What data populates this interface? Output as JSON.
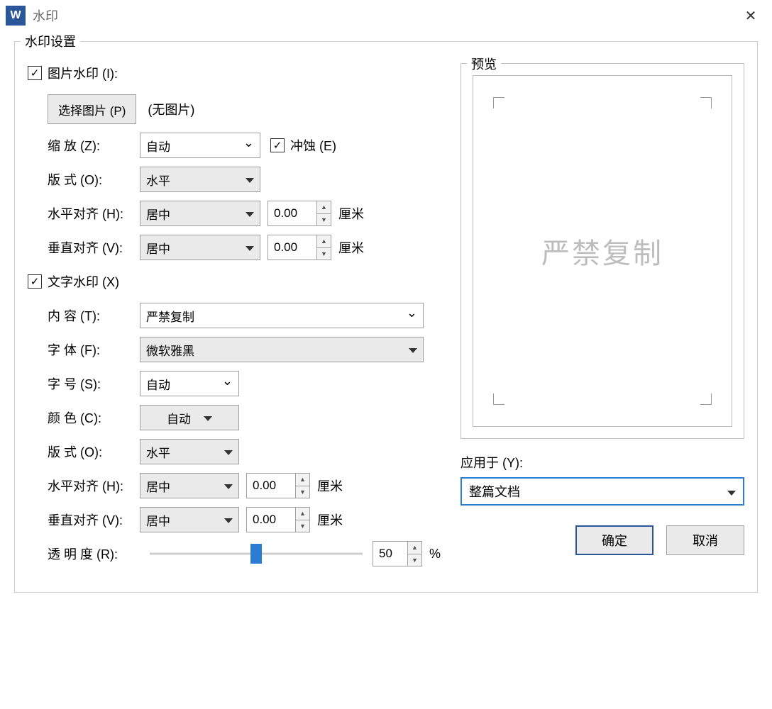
{
  "window": {
    "icon_letter": "W",
    "title": "水印"
  },
  "group": {
    "settings_title": "水印设置",
    "preview_title": "预览"
  },
  "pic": {
    "checkbox_label": "图片水印 (I):",
    "select_button": "选择图片 (P)",
    "no_image": "(无图片)",
    "scale_label": "缩   放 (Z):",
    "scale_value": "自动",
    "washout_label": "冲蚀 (E)",
    "layout_label": "版   式 (O):",
    "layout_value": "水平",
    "halign_label": "水平对齐 (H):",
    "halign_value": "居中",
    "halign_offset": "0.00",
    "valign_label": "垂直对齐 (V):",
    "valign_value": "居中",
    "valign_offset": "0.00",
    "unit": "厘米"
  },
  "text": {
    "checkbox_label": "文字水印 (X)",
    "content_label": "内   容 (T):",
    "content_value": "严禁复制",
    "font_label": "字   体 (F):",
    "font_value": "微软雅黑",
    "size_label": "字   号 (S):",
    "size_value": "自动",
    "color_label": "颜   色 (C):",
    "color_value": "自动",
    "layout_label": "版   式 (O):",
    "layout_value": "水平",
    "halign_label": "水平对齐 (H):",
    "halign_value": "居中",
    "halign_offset": "0.00",
    "valign_label": "垂直对齐 (V):",
    "valign_value": "居中",
    "valign_offset": "0.00",
    "unit": "厘米",
    "opacity_label": "透 明 度 (R):",
    "opacity_value": "50",
    "opacity_unit": "%"
  },
  "apply": {
    "label": "应用于 (Y):",
    "value": "整篇文档"
  },
  "buttons": {
    "ok": "确定",
    "cancel": "取消"
  },
  "preview_text": "严禁复制"
}
